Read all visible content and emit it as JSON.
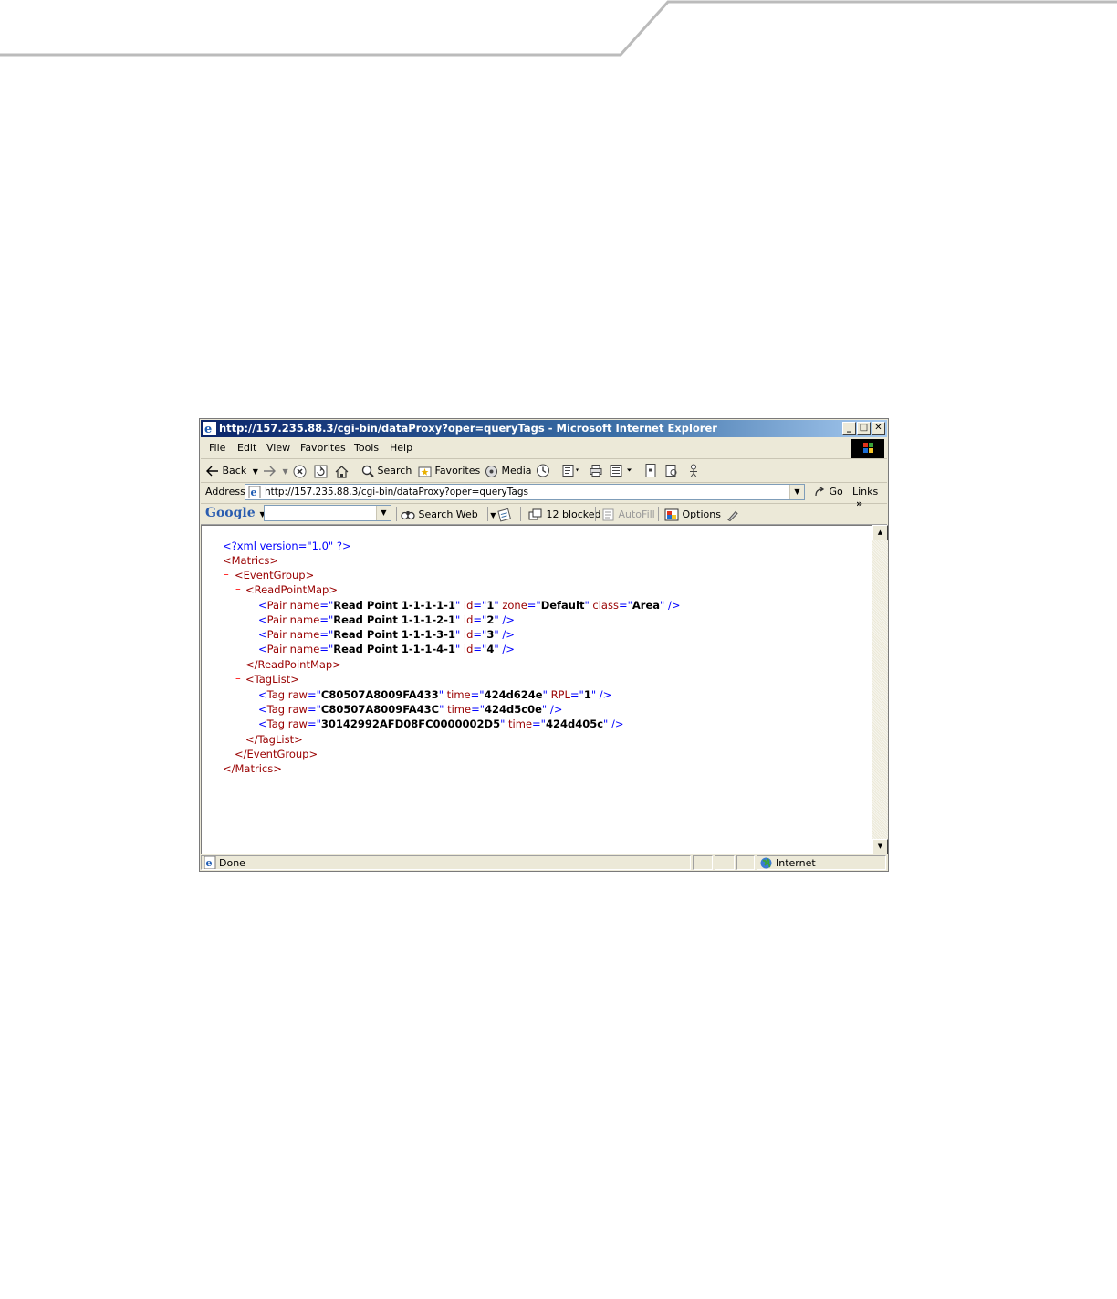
{
  "window": {
    "title": "http://157.235.88.3/cgi-bin/dataProxy?oper=queryTags - Microsoft Internet Explorer",
    "minimize": "_",
    "maximize": "□",
    "close": "✕"
  },
  "menu": [
    "File",
    "Edit",
    "View",
    "Favorites",
    "Tools",
    "Help"
  ],
  "toolbar": {
    "back": "Back",
    "search": "Search",
    "favorites": "Favorites",
    "media": "Media"
  },
  "address": {
    "label": "Address",
    "url": "http://157.235.88.3/cgi-bin/dataProxy?oper=queryTags",
    "go": "Go",
    "links": "Links"
  },
  "google": {
    "logo": "Google",
    "search_web": "Search Web",
    "blocked": "12 blocked",
    "autofill": "AutoFill",
    "options": "Options"
  },
  "xml": {
    "decl": "<?xml version=\"1.0\" ?>",
    "matrics_open": "<Matrics>",
    "eventgroup_open": "<EventGroup>",
    "readpointmap_open": "<ReadPointMap>",
    "pairs": [
      {
        "name": "Read Point 1-1-1-1-1",
        "id": "1",
        "zone": "Default",
        "class": "Area"
      },
      {
        "name": "Read Point 1-1-1-2-1",
        "id": "2"
      },
      {
        "name": "Read Point 1-1-1-3-1",
        "id": "3"
      },
      {
        "name": "Read Point 1-1-1-4-1",
        "id": "4"
      }
    ],
    "readpointmap_close": "</ReadPointMap>",
    "taglist_open": "<TagList>",
    "tags": [
      {
        "raw": "C80507A8009FA433",
        "time": "424d624e",
        "rpl": "1"
      },
      {
        "raw": "C80507A8009FA43C",
        "time": "424d5c0e"
      },
      {
        "raw": "30142992AFD08FC0000002D5",
        "time": "424d405c"
      }
    ],
    "taglist_close": "</TagList>",
    "eventgroup_close": "</EventGroup>",
    "matrics_close": "</Matrics>"
  },
  "status": {
    "text": "Done",
    "zone": "Internet"
  }
}
